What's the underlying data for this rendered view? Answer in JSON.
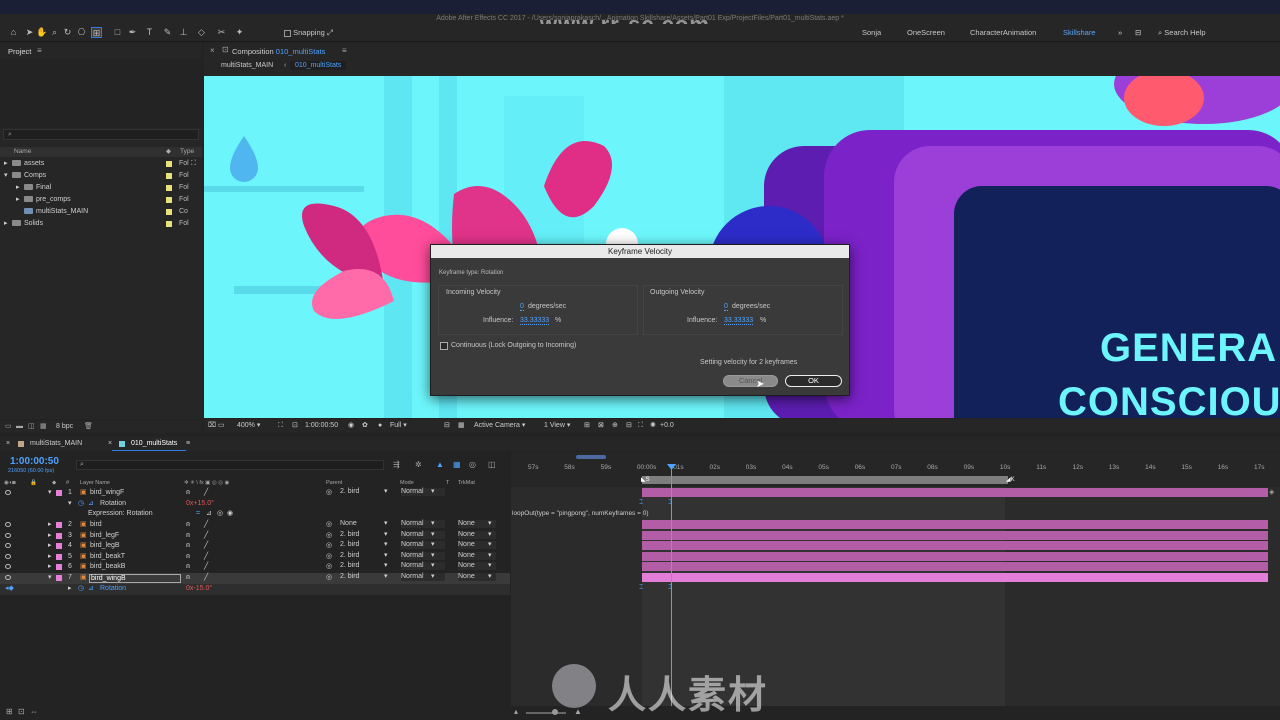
{
  "app_title": "Adobe After Effects CC 2017 - /Users/sonjaprakasch/...Animation Skillshare/Assets/Part01 Exp/ProjectFiles/Part01_multiStats.aep *",
  "watermark_top": "www.rr-sc.com",
  "watermark_bottom": "人人素材",
  "toolbar": {
    "snapping_label": "Snapping",
    "workspaces": [
      "Sonja",
      "OneScreen",
      "CharacterAnimation",
      "Skillshare"
    ],
    "active_workspace": "Skillshare",
    "search_help": "Search Help"
  },
  "project": {
    "title": "Project",
    "col_name": "Name",
    "col_type": "Type",
    "items": [
      {
        "name": "assets",
        "type": "Fol"
      },
      {
        "name": "Comps",
        "type": "Fol"
      },
      {
        "name": "Final",
        "type": "Fol"
      },
      {
        "name": "pre_comps",
        "type": "Fol"
      },
      {
        "name": "multiStats_MAIN",
        "type": "Co"
      },
      {
        "name": "Solids",
        "type": "Fol"
      }
    ],
    "bpc": "8 bpc"
  },
  "composition": {
    "panel_label": "Composition",
    "comp_name": "010_multiStats",
    "breadcrumb_parent": "multiStats_MAIN",
    "breadcrumb_current": "010_multiStats",
    "viewer_text_line1": "GENERA",
    "viewer_text_line2": "CONSCIOU",
    "zoom": "400%",
    "timecode": "1:00:00:50",
    "resolution": "Full",
    "camera": "Active Camera",
    "views": "1 View",
    "exposure": "+0.0"
  },
  "dialog": {
    "title": "Keyframe Velocity",
    "keyframe_type": "Keyframe type: Rotation",
    "incoming_label": "Incoming Velocity",
    "incoming_value": "0",
    "incoming_unit": "degrees/sec",
    "incoming_influence_label": "Influence:",
    "incoming_influence": "33.33333",
    "pct": "%",
    "outgoing_label": "Outgoing Velocity",
    "outgoing_value": "0",
    "outgoing_unit": "degrees/sec",
    "outgoing_influence_label": "Influence:",
    "outgoing_influence": "33.33333",
    "continuous_label": "Continuous (Lock Outgoing to Incoming)",
    "status": "Setting velocity for 2 keyframes",
    "cancel_label": "Cancel",
    "ok_label": "OK"
  },
  "timeline": {
    "tabs": [
      "multiStats_MAIN",
      "010_multiStats"
    ],
    "timecode": "1:00:00:50",
    "frames": "216050 (60.00 fps)",
    "col_layer_name": "Layer Name",
    "col_parent": "Parent",
    "col_mode": "Mode",
    "col_t": "T",
    "col_trkmat": "TrkMat",
    "layers": [
      {
        "num": "1",
        "name": "bird_wingF",
        "parent": "2. bird",
        "mode": "Normal",
        "trkmat": ""
      },
      {
        "num": "2",
        "name": "bird",
        "parent": "None",
        "mode": "Normal",
        "trkmat": "None"
      },
      {
        "num": "3",
        "name": "bird_legF",
        "parent": "2. bird",
        "mode": "Normal",
        "trkmat": "None"
      },
      {
        "num": "4",
        "name": "bird_legB",
        "parent": "2. bird",
        "mode": "Normal",
        "trkmat": "None"
      },
      {
        "num": "5",
        "name": "bird_beakT",
        "parent": "2. bird",
        "mode": "Normal",
        "trkmat": "None"
      },
      {
        "num": "6",
        "name": "bird_beakB",
        "parent": "2. bird",
        "mode": "Normal",
        "trkmat": "None"
      },
      {
        "num": "7",
        "name": "bird_wingB",
        "parent": "2. bird",
        "mode": "Normal",
        "trkmat": "None"
      }
    ],
    "rotation_label": "Rotation",
    "rotation_value": "0x+15.0°",
    "rotation_value_b": "0x-15.0°",
    "expression_label": "Expression: Rotation",
    "expression_text": "loopOut(type = \"pingpong\", numKeyframes = 0)",
    "ruler": [
      "57s",
      "58s",
      "59s",
      "00:00s",
      "01s",
      "02s",
      "03s",
      "04s",
      "05s",
      "06s",
      "07s",
      "08s",
      "09s",
      "10s",
      "11s",
      "12s",
      "13s",
      "14s",
      "15s",
      "16s",
      "17s"
    ]
  }
}
